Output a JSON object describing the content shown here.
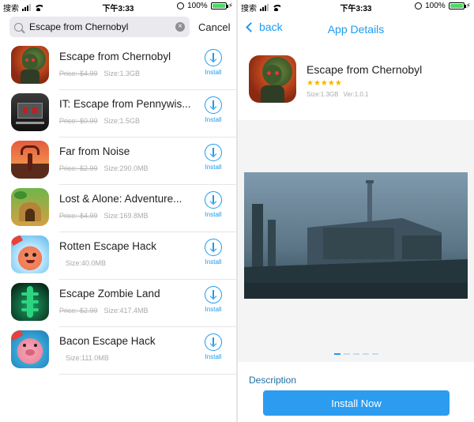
{
  "status_bar": {
    "carrier": "搜索",
    "time": "下午3:33",
    "battery": "100%",
    "battery_level": 1.0
  },
  "search": {
    "value": "Escape from Chernobyl",
    "cancel_label": "Cancel"
  },
  "results": [
    {
      "name": "Escape from Chernobyl",
      "price": "Price:-$4.99",
      "size": "Size:1.3GB",
      "install_label": "Install",
      "icon": "chernobyl-zombie-icon"
    },
    {
      "name": "IT: Escape from Pennywis...",
      "price": "Price:-$0.99",
      "size": "Size:1.5GB",
      "install_label": "Install",
      "icon": "haunted-house-icon"
    },
    {
      "name": "Far from Noise",
      "price": "Price:-$2.99",
      "size": "Size:290.0MB",
      "install_label": "Install",
      "icon": "deer-icon"
    },
    {
      "name": "Lost & Alone: Adventure...",
      "price": "Price:-$4.99",
      "size": "Size:169.8MB",
      "install_label": "Install",
      "icon": "ruins-icon"
    },
    {
      "name": "Rotten Escape Hack",
      "price": "",
      "size": "Size:40.0MB",
      "install_label": "Install",
      "icon": "tomato-icon"
    },
    {
      "name": "Escape Zombie Land",
      "price": "Price:-$2.99",
      "size": "Size:417.4MB",
      "install_label": "Install",
      "icon": "zombie-hands-icon"
    },
    {
      "name": "Bacon Escape Hack",
      "price": "",
      "size": "Size:111.0MB",
      "install_label": "Install",
      "icon": "pig-icon"
    }
  ],
  "details": {
    "back_label": "back",
    "title": "App Details",
    "app_name": "Escape from Chernobyl",
    "stars": "★★★★★",
    "size": "Size:1.3GB",
    "version": "Ver:1.0.1",
    "screenshot_count": 5,
    "active_screenshot": 1,
    "description_label": "Description",
    "install_now_label": "Install Now"
  },
  "colors": {
    "accent": "#1d9bf0",
    "install_button": "#2c9cf0",
    "stars": "#f5b400"
  }
}
